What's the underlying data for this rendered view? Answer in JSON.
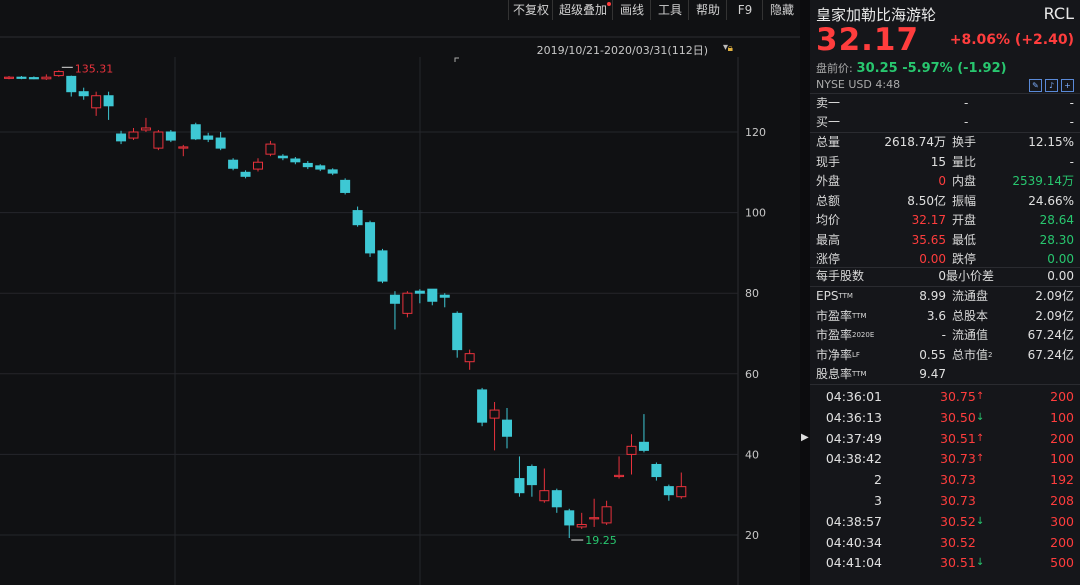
{
  "toolbar": {
    "items": [
      {
        "label": "不复权",
        "dot": false
      },
      {
        "label": "超级叠加",
        "dot": true
      },
      {
        "label": "画线",
        "dot": false
      },
      {
        "label": "工具",
        "dot": false
      },
      {
        "label": "帮助",
        "dot": false
      },
      {
        "label": "F9",
        "dot": false
      },
      {
        "label": "隐藏",
        "dot": false
      }
    ]
  },
  "chart": {
    "range_label": "2019/10/21-2020/03/31(112日)",
    "high_label": "135.31",
    "low_label": "19.25"
  },
  "chart_data": {
    "type": "candlestick",
    "y_ticks": [
      20,
      40,
      60,
      80,
      100,
      120
    ],
    "ylim": [
      15,
      143
    ],
    "grid": true,
    "colors": {
      "up": "#e8323c",
      "down": "#3ec8d4"
    },
    "candles": [
      {
        "o": 133.4,
        "c": 133.6,
        "h": 133.9,
        "l": 133.1
      },
      {
        "o": 133.6,
        "c": 133.4,
        "h": 133.9,
        "l": 133.1
      },
      {
        "o": 133.5,
        "c": 133.4,
        "h": 133.8,
        "l": 133.1
      },
      {
        "o": 133.2,
        "c": 133.6,
        "h": 134.3,
        "l": 132.9
      },
      {
        "o": 134.0,
        "c": 135.0,
        "h": 135.31,
        "l": 133.7
      },
      {
        "o": 133.8,
        "c": 130.0,
        "h": 134.0,
        "l": 128.8
      },
      {
        "o": 130.0,
        "c": 129.0,
        "h": 131.0,
        "l": 128.0
      },
      {
        "o": 126.0,
        "c": 129.0,
        "h": 130.0,
        "l": 124.0
      },
      {
        "o": 129.0,
        "c": 126.5,
        "h": 130.0,
        "l": 123.0
      },
      {
        "o": 119.5,
        "c": 117.8,
        "h": 120.3,
        "l": 117.0
      },
      {
        "o": 118.5,
        "c": 120.0,
        "h": 121.0,
        "l": 118.0
      },
      {
        "o": 120.5,
        "c": 121.0,
        "h": 123.5,
        "l": 120.0
      },
      {
        "o": 116.0,
        "c": 120.0,
        "h": 120.5,
        "l": 115.5
      },
      {
        "o": 120.0,
        "c": 118.0,
        "h": 120.5,
        "l": 117.5
      },
      {
        "o": 116.0,
        "c": 116.3,
        "h": 116.8,
        "l": 114.0
      },
      {
        "o": 121.8,
        "c": 118.3,
        "h": 122.3,
        "l": 118.0
      },
      {
        "o": 119.0,
        "c": 118.2,
        "h": 119.8,
        "l": 117.5
      },
      {
        "o": 118.5,
        "c": 116.0,
        "h": 120.0,
        "l": 115.5
      },
      {
        "o": 113.0,
        "c": 111.0,
        "h": 113.5,
        "l": 110.5
      },
      {
        "o": 110.0,
        "c": 109.0,
        "h": 110.5,
        "l": 108.5
      },
      {
        "o": 110.8,
        "c": 112.5,
        "h": 113.5,
        "l": 110.2
      },
      {
        "o": 114.5,
        "c": 117.0,
        "h": 117.8,
        "l": 114.0
      },
      {
        "o": 114.0,
        "c": 113.6,
        "h": 114.5,
        "l": 113.0
      },
      {
        "o": 113.3,
        "c": 112.6,
        "h": 113.8,
        "l": 112.0
      },
      {
        "o": 112.2,
        "c": 111.4,
        "h": 112.8,
        "l": 110.8
      },
      {
        "o": 111.6,
        "c": 110.8,
        "h": 112.0,
        "l": 110.3
      },
      {
        "o": 110.6,
        "c": 109.8,
        "h": 111.0,
        "l": 109.3
      },
      {
        "o": 108.0,
        "c": 105.0,
        "h": 108.5,
        "l": 104.5
      },
      {
        "o": 100.5,
        "c": 97.0,
        "h": 101.5,
        "l": 96.5
      },
      {
        "o": 97.5,
        "c": 90.0,
        "h": 98.0,
        "l": 89.0
      },
      {
        "o": 90.5,
        "c": 83.0,
        "h": 91.0,
        "l": 82.5
      },
      {
        "o": 79.5,
        "c": 77.5,
        "h": 80.5,
        "l": 71.0
      },
      {
        "o": 75.0,
        "c": 80.0,
        "h": 80.5,
        "l": 74.0
      },
      {
        "o": 80.5,
        "c": 80.0,
        "h": 81.0,
        "l": 77.5
      },
      {
        "o": 81.0,
        "c": 78.0,
        "h": 81.0,
        "l": 77.0
      },
      {
        "o": 79.5,
        "c": 79.0,
        "h": 80.0,
        "l": 76.5
      },
      {
        "o": 75.0,
        "c": 66.0,
        "h": 75.5,
        "l": 64.0
      },
      {
        "o": 63.0,
        "c": 65.0,
        "h": 66.0,
        "l": 61.0
      },
      {
        "o": 56.0,
        "c": 48.0,
        "h": 56.5,
        "l": 47.0
      },
      {
        "o": 49.0,
        "c": 51.0,
        "h": 53.0,
        "l": 41.0
      },
      {
        "o": 48.5,
        "c": 44.5,
        "h": 51.5,
        "l": 41.5
      },
      {
        "o": 34.0,
        "c": 30.5,
        "h": 39.5,
        "l": 29.5
      },
      {
        "o": 37.0,
        "c": 32.5,
        "h": 37.5,
        "l": 29.5
      },
      {
        "o": 28.5,
        "c": 31.0,
        "h": 36.5,
        "l": 28.0
      },
      {
        "o": 31.0,
        "c": 27.0,
        "h": 31.5,
        "l": 25.5
      },
      {
        "o": 26.0,
        "c": 22.5,
        "h": 26.5,
        "l": 19.25
      },
      {
        "o": 22.0,
        "c": 22.6,
        "h": 25.5,
        "l": 21.5
      },
      {
        "o": 24.0,
        "c": 24.3,
        "h": 29.0,
        "l": 22.0
      },
      {
        "o": 23.0,
        "c": 27.0,
        "h": 28.5,
        "l": 22.5
      },
      {
        "o": 34.5,
        "c": 34.8,
        "h": 39.5,
        "l": 34.0
      },
      {
        "o": 40.0,
        "c": 42.0,
        "h": 45.0,
        "l": 35.0
      },
      {
        "o": 43.0,
        "c": 41.0,
        "h": 50.0,
        "l": 40.5
      },
      {
        "o": 37.5,
        "c": 34.5,
        "h": 38.0,
        "l": 33.5
      },
      {
        "o": 32.0,
        "c": 30.0,
        "h": 32.5,
        "l": 28.5
      },
      {
        "o": 29.5,
        "c": 32.0,
        "h": 35.5,
        "l": 29.0
      }
    ]
  },
  "quote": {
    "name": "皇家加勒比海游轮",
    "code": "RCL",
    "price": "32.17",
    "change": "+8.06% (+2.40)",
    "pre_label": "盘前价:",
    "pre_value": "30.25 -5.97% (-1.92)",
    "market": "NYSE   USD   4:48"
  },
  "orderbook": [
    {
      "label": "卖一",
      "price": "-",
      "vol": "-"
    },
    {
      "label": "买一",
      "price": "-",
      "vol": "-"
    }
  ],
  "stats": [
    {
      "l1": "总量",
      "v1": "2618.74万",
      "c1": "",
      "l2": "换手",
      "v2": "12.15%",
      "c2": ""
    },
    {
      "l1": "现手",
      "v1": "15",
      "c1": "",
      "l2": "量比",
      "v2": "-",
      "c2": ""
    },
    {
      "l1": "外盘",
      "v1": "0",
      "c1": "red",
      "l2": "内盘",
      "v2": "2539.14万",
      "c2": "green"
    },
    {
      "l1": "总额",
      "v1": "8.50亿",
      "c1": "",
      "l2": "振幅",
      "v2": "24.66%",
      "c2": ""
    },
    {
      "l1": "均价",
      "v1": "32.17",
      "c1": "red",
      "l2": "开盘",
      "v2": "28.64",
      "c2": "green"
    },
    {
      "l1": "最高",
      "v1": "35.65",
      "c1": "red",
      "l2": "最低",
      "v2": "28.30",
      "c2": "green"
    },
    {
      "l1": "涨停",
      "v1": "0.00",
      "c1": "red",
      "l2": "跌停",
      "v2": "0.00",
      "c2": "green"
    }
  ],
  "lot": {
    "l1": "每手股数",
    "v1": "0",
    "l2": "最小价差",
    "v2": "0.00"
  },
  "fundamentals": [
    {
      "l1": "EPS",
      "s1": "TTM",
      "v1": "8.99",
      "l2": "流通盘",
      "s2": "",
      "v2": "2.09亿"
    },
    {
      "l1": "市盈率",
      "s1": "TTM",
      "v1": "3.6",
      "l2": "总股本",
      "s2": "",
      "v2": "2.09亿"
    },
    {
      "l1": "市盈率",
      "s1": "2020E",
      "v1": "-",
      "l2": "流通值",
      "s2": "",
      "v2": "67.24亿"
    },
    {
      "l1": "市净率",
      "s1": "LF",
      "v1": "0.55",
      "l2": "总市值",
      "s2": "2",
      "v2": "67.24亿"
    },
    {
      "l1": "股息率",
      "s1": "TTM",
      "v1": "9.47",
      "l2": "",
      "s2": "",
      "v2": ""
    }
  ],
  "trades": [
    {
      "time": "04:36:01",
      "price": "30.75",
      "dir": "up",
      "vol": "200",
      "vcolor": "red"
    },
    {
      "time": "04:36:13",
      "price": "30.50",
      "dir": "down",
      "vol": "100",
      "vcolor": "red"
    },
    {
      "time": "04:37:49",
      "price": "30.51",
      "dir": "up",
      "vol": "200",
      "vcolor": "red"
    },
    {
      "time": "04:38:42",
      "price": "30.73",
      "dir": "up",
      "vol": "100",
      "vcolor": "red"
    },
    {
      "time": "2",
      "price": "30.73",
      "dir": "",
      "vol": "192",
      "vcolor": "red"
    },
    {
      "time": "3",
      "price": "30.73",
      "dir": "",
      "vol": "208",
      "vcolor": "red"
    },
    {
      "time": "04:38:57",
      "price": "30.52",
      "dir": "down",
      "vol": "300",
      "vcolor": "red"
    },
    {
      "time": "04:40:34",
      "price": "30.52",
      "dir": "",
      "vol": "200",
      "vcolor": "red"
    },
    {
      "time": "04:41:04",
      "price": "30.51",
      "dir": "down",
      "vol": "500",
      "vcolor": "red"
    }
  ]
}
